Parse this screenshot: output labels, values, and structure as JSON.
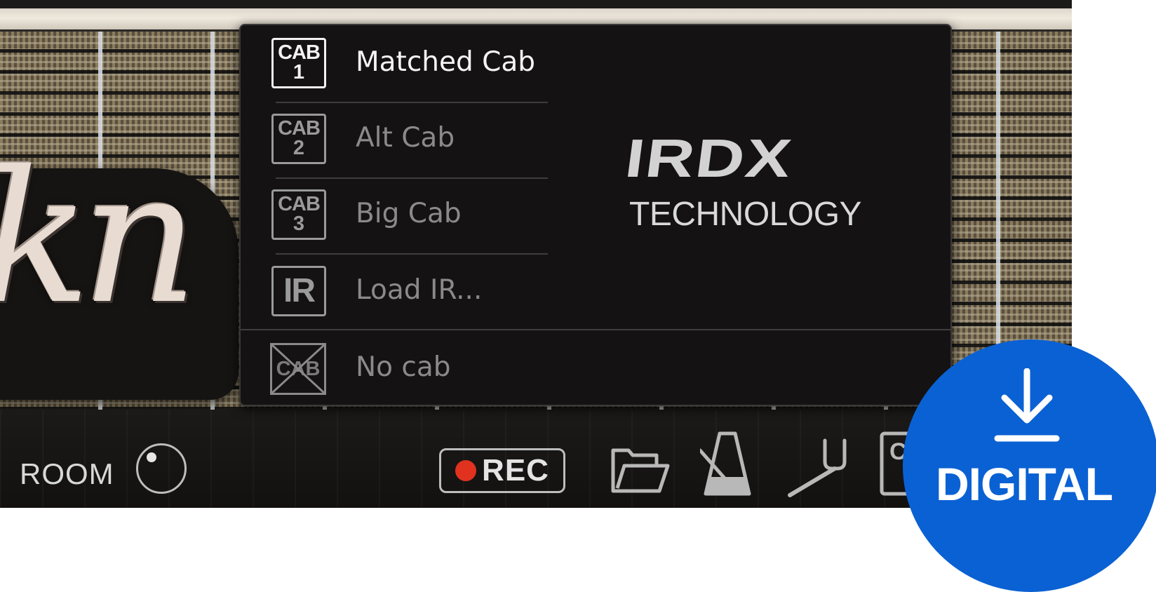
{
  "amp": {
    "logo_script": "kn",
    "room_label": "ROOM",
    "rec_label": "REC",
    "partial_icon_letter": "C"
  },
  "cab_menu": {
    "items": [
      {
        "icon_line1": "CAB",
        "icon_line2": "1",
        "label": "Matched Cab",
        "selected": true
      },
      {
        "icon_line1": "CAB",
        "icon_line2": "2",
        "label": "Alt Cab",
        "selected": false
      },
      {
        "icon_line1": "CAB",
        "icon_line2": "3",
        "label": "Big Cab",
        "selected": false
      },
      {
        "icon_line1": "IR",
        "label": "Load IR...",
        "selected": false
      },
      {
        "icon_line1": "CAB",
        "label": "No cab",
        "selected": false
      }
    ],
    "brand": {
      "mark": "IRDX",
      "subtitle": "TECHNOLOGY"
    }
  },
  "badge": {
    "label": "DIGITAL",
    "icon": "download-icon",
    "color": "#0a61d3"
  },
  "colors": {
    "rec_dot": "#e0321f",
    "menu_bg": "#141212"
  }
}
